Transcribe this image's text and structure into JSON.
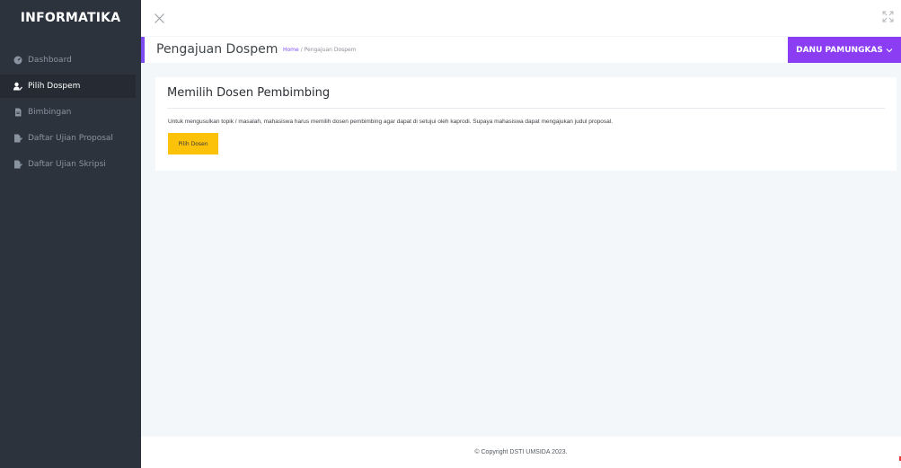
{
  "sidebar": {
    "brand": "INFORMATIKA",
    "items": [
      {
        "label": "Dashboard",
        "icon": "dashboard-icon",
        "active": false
      },
      {
        "label": "Pilih Dospem",
        "icon": "user-pen-icon",
        "active": true
      },
      {
        "label": "Bimbingan",
        "icon": "file-icon",
        "active": false
      },
      {
        "label": "Daftar Ujian Proposal",
        "icon": "file-pen-icon",
        "active": false
      },
      {
        "label": "Daftar Ujian Skripsi",
        "icon": "file-pen-icon",
        "active": false
      }
    ]
  },
  "topbar": {
    "close_icon": "close-icon",
    "expand_icon": "fullscreen-icon"
  },
  "header": {
    "title": "Pengajuan Dospem",
    "breadcrumb": {
      "home": "Home",
      "separator": "/",
      "current": "Pengajuan Dospem"
    },
    "user_name": "DANU PAMUNGKAS"
  },
  "card": {
    "title": "Memilih Dosen Pembimbing",
    "text": "Untuk mengusulkan topik / masalah, mahasiswa harus memilih dosen pembimbing agar dapat di setujui oleh kaprodi. Supaya mahasiswa dapat mengajukan judul proposal.",
    "button_label": "Pilih Dosen"
  },
  "footer": {
    "copyright": "© Copyright DSTI UMSIDA 2023."
  },
  "colors": {
    "sidebar_bg": "#2d333d",
    "accent": "#8a3df2",
    "button_yellow": "#fcc20a",
    "page_bg": "#f4f7fa"
  }
}
